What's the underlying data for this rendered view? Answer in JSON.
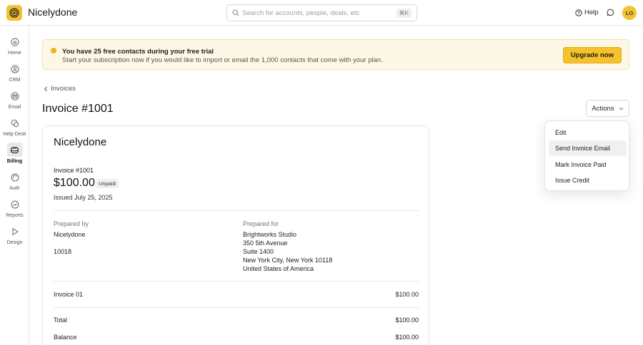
{
  "app": {
    "name": "Nicelydone"
  },
  "search": {
    "placeholder": "Search for accounts, people, deals, etc",
    "shortcut": "⌘K"
  },
  "header": {
    "help_label": "Help",
    "avatar_initials": "LO"
  },
  "sidebar": {
    "items": [
      {
        "label": "Home",
        "icon": "home-icon"
      },
      {
        "label": "CRM",
        "icon": "crm-icon"
      },
      {
        "label": "Email",
        "icon": "email-icon"
      },
      {
        "label": "Help Desk",
        "icon": "help-desk-icon"
      },
      {
        "label": "Billing",
        "icon": "billing-icon",
        "active": true
      },
      {
        "label": "Auth",
        "icon": "auth-icon"
      },
      {
        "label": "Reports",
        "icon": "reports-icon"
      },
      {
        "label": "Design",
        "icon": "design-icon"
      }
    ]
  },
  "banner": {
    "title": "You have 25 free contacts during your free trial",
    "subtitle": "Start your subscription now if you would like to import or email the 1,000 contacts that come with your plan.",
    "button_label": "Upgrade now"
  },
  "breadcrumb": {
    "label": "Invoices"
  },
  "page": {
    "title": "Invoice #1001",
    "actions_label": "Actions"
  },
  "actions_menu": {
    "items": [
      "Edit",
      "Send Invoice Email",
      "Mark Invoice Paid",
      "Issue Credit"
    ],
    "highlighted_index": 1
  },
  "invoice": {
    "company": "Nicelydone",
    "number": "Invoice #1001",
    "amount": "$100.00",
    "status": "Unpaid",
    "issued": "Issued July 25, 2025",
    "prepared_by_label": "Prepared by",
    "prepared_by_name": "Nicelydone",
    "prepared_by_extra": "10018",
    "prepared_for_label": "Prepared for",
    "prepared_for_name": "Brightworks Studio",
    "prepared_for_address": [
      "350 5th Avenue",
      "Suite 1400",
      "New York City, New York 10118",
      "United States of America"
    ],
    "line_item": {
      "label": "Invoice 01",
      "amount": "$100.00"
    },
    "total": {
      "label": "Total",
      "amount": "$100.00"
    },
    "balance": {
      "label": "Balance",
      "amount": "$100.00"
    }
  },
  "colors": {
    "accent": "#f5c22b",
    "banner_bg": "#fdf8e5",
    "border": "#e6e6e6"
  }
}
